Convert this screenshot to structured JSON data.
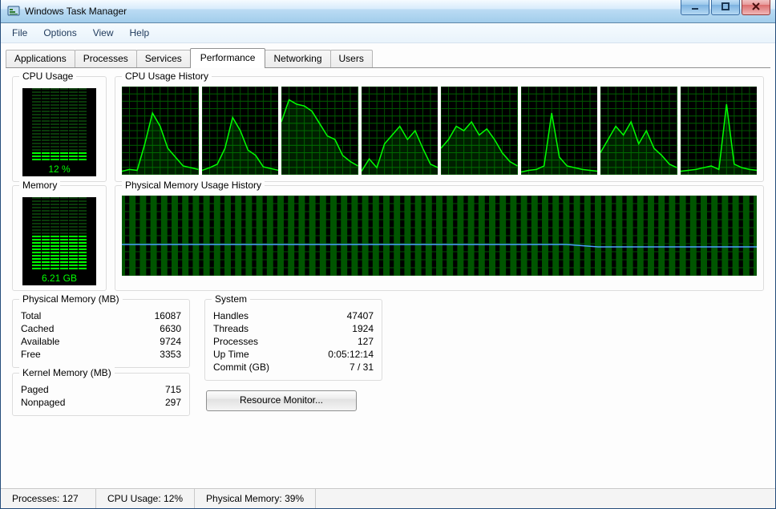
{
  "window": {
    "title": "Windows Task Manager"
  },
  "menu": {
    "items": [
      "File",
      "Options",
      "View",
      "Help"
    ]
  },
  "tabs": {
    "items": [
      "Applications",
      "Processes",
      "Services",
      "Performance",
      "Networking",
      "Users"
    ],
    "active": 3
  },
  "perf": {
    "cpu_usage_label": "CPU Usage",
    "cpu_usage_value": "12 %",
    "cpu_history_label": "CPU Usage History",
    "memory_label": "Memory",
    "memory_value": "6.21 GB",
    "memory_history_label": "Physical Memory Usage History"
  },
  "physmem": {
    "title": "Physical Memory (MB)",
    "rows": [
      {
        "k": "Total",
        "v": "16087"
      },
      {
        "k": "Cached",
        "v": "6630"
      },
      {
        "k": "Available",
        "v": "9724"
      },
      {
        "k": "Free",
        "v": "3353"
      }
    ]
  },
  "kernelmem": {
    "title": "Kernel Memory (MB)",
    "rows": [
      {
        "k": "Paged",
        "v": "715"
      },
      {
        "k": "Nonpaged",
        "v": "297"
      }
    ]
  },
  "system": {
    "title": "System",
    "rows": [
      {
        "k": "Handles",
        "v": "47407"
      },
      {
        "k": "Threads",
        "v": "1924"
      },
      {
        "k": "Processes",
        "v": "127"
      },
      {
        "k": "Up Time",
        "v": "0:05:12:14"
      },
      {
        "k": "Commit (GB)",
        "v": "7 / 31"
      }
    ]
  },
  "resource_monitor_label": "Resource Monitor...",
  "status": {
    "processes": "Processes: 127",
    "cpu": "CPU Usage: 12%",
    "mem": "Physical Memory: 39%"
  },
  "chart_data": [
    {
      "type": "area",
      "title": "CPU core 1",
      "ylim": [
        0,
        100
      ],
      "x": [
        0,
        10,
        20,
        30,
        40,
        50,
        60,
        70,
        80,
        90,
        100
      ],
      "values": [
        4,
        6,
        5,
        35,
        70,
        55,
        30,
        20,
        10,
        8,
        6
      ]
    },
    {
      "type": "area",
      "title": "CPU core 2",
      "ylim": [
        0,
        100
      ],
      "x": [
        0,
        10,
        20,
        30,
        40,
        50,
        60,
        70,
        80,
        90,
        100
      ],
      "values": [
        5,
        8,
        12,
        30,
        65,
        50,
        28,
        22,
        9,
        7,
        5
      ]
    },
    {
      "type": "area",
      "title": "CPU core 3",
      "ylim": [
        0,
        100
      ],
      "x": [
        0,
        10,
        20,
        30,
        40,
        50,
        60,
        70,
        80,
        90,
        100
      ],
      "values": [
        60,
        85,
        80,
        78,
        72,
        58,
        44,
        40,
        22,
        15,
        10
      ]
    },
    {
      "type": "area",
      "title": "CPU core 4",
      "ylim": [
        0,
        100
      ],
      "x": [
        0,
        10,
        20,
        30,
        40,
        50,
        60,
        70,
        80,
        90,
        100
      ],
      "values": [
        4,
        18,
        8,
        35,
        45,
        55,
        40,
        50,
        30,
        12,
        8
      ]
    },
    {
      "type": "area",
      "title": "CPU core 5",
      "ylim": [
        0,
        100
      ],
      "x": [
        0,
        10,
        20,
        30,
        40,
        50,
        60,
        70,
        80,
        90,
        100
      ],
      "values": [
        30,
        40,
        55,
        50,
        60,
        45,
        52,
        40,
        25,
        15,
        10
      ]
    },
    {
      "type": "area",
      "title": "CPU core 6",
      "ylim": [
        0,
        100
      ],
      "x": [
        0,
        10,
        20,
        30,
        40,
        50,
        60,
        70,
        80,
        90,
        100
      ],
      "values": [
        3,
        5,
        6,
        10,
        70,
        20,
        10,
        8,
        6,
        5,
        4
      ]
    },
    {
      "type": "area",
      "title": "CPU core 7",
      "ylim": [
        0,
        100
      ],
      "x": [
        0,
        10,
        20,
        30,
        40,
        50,
        60,
        70,
        80,
        90,
        100
      ],
      "values": [
        25,
        40,
        55,
        45,
        60,
        35,
        50,
        30,
        22,
        12,
        8
      ]
    },
    {
      "type": "area",
      "title": "CPU core 8",
      "ylim": [
        0,
        100
      ],
      "x": [
        0,
        10,
        20,
        30,
        40,
        50,
        60,
        70,
        80,
        90,
        100
      ],
      "values": [
        4,
        5,
        6,
        8,
        10,
        6,
        80,
        12,
        8,
        6,
        5
      ]
    },
    {
      "type": "line",
      "title": "Physical Memory Usage History",
      "ylim": [
        0,
        100
      ],
      "x": [
        0,
        10,
        20,
        30,
        40,
        50,
        60,
        70,
        75,
        80,
        100
      ],
      "values": [
        39,
        39,
        39,
        39,
        39,
        39,
        39,
        39,
        36,
        36,
        36
      ]
    }
  ],
  "gauges": {
    "cpu_pct": 12,
    "mem_pct": 39
  },
  "colors": {
    "grid": "#005500",
    "trace": "#00ff00",
    "mem_trace": "#4aa0ff"
  }
}
